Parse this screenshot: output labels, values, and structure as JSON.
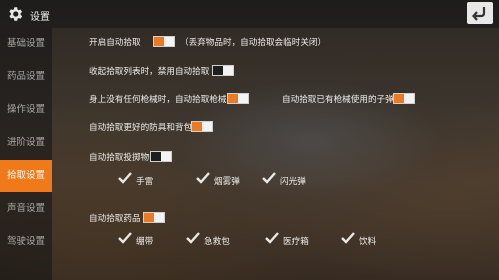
{
  "header": {
    "title": "设置"
  },
  "sidebar": {
    "items": [
      {
        "label": "基础设置",
        "active": false
      },
      {
        "label": "药品设置",
        "active": false
      },
      {
        "label": "操作设置",
        "active": false
      },
      {
        "label": "进阶设置",
        "active": false
      },
      {
        "label": "拾取设置",
        "active": true
      },
      {
        "label": "声音设置",
        "active": false
      },
      {
        "label": "驾驶设置",
        "active": false
      }
    ]
  },
  "settings": {
    "auto_pickup": {
      "label": "开启自动拾取",
      "on": true,
      "hint": "（丢弃物品时，自动拾取会临时关闭）"
    },
    "collapse_list": {
      "label": "收起拾取列表时，禁用自动拾取",
      "on": false
    },
    "auto_gun": {
      "label": "身上没有任何枪械时，自动拾取枪械",
      "on": true
    },
    "auto_ammo": {
      "label": "自动拾取已有枪械使用的子弹",
      "on": true
    },
    "auto_armor": {
      "label": "自动拾取更好的防具和背包",
      "on": true
    },
    "auto_throwables": {
      "label": "自动拾取投掷物",
      "on": false,
      "options": [
        {
          "label": "手雷",
          "checked": true
        },
        {
          "label": "烟雾弹",
          "checked": true
        },
        {
          "label": "闪光弹",
          "checked": true
        }
      ]
    },
    "auto_medicine": {
      "label": "自动拾取药品",
      "on": true,
      "options": [
        {
          "label": "绷带",
          "checked": true
        },
        {
          "label": "急救包",
          "checked": true
        },
        {
          "label": "医疗箱",
          "checked": true
        },
        {
          "label": "饮料",
          "checked": true
        }
      ]
    }
  },
  "colors": {
    "accent": "#f07a1a",
    "toggle_on": "#ea7b24"
  }
}
